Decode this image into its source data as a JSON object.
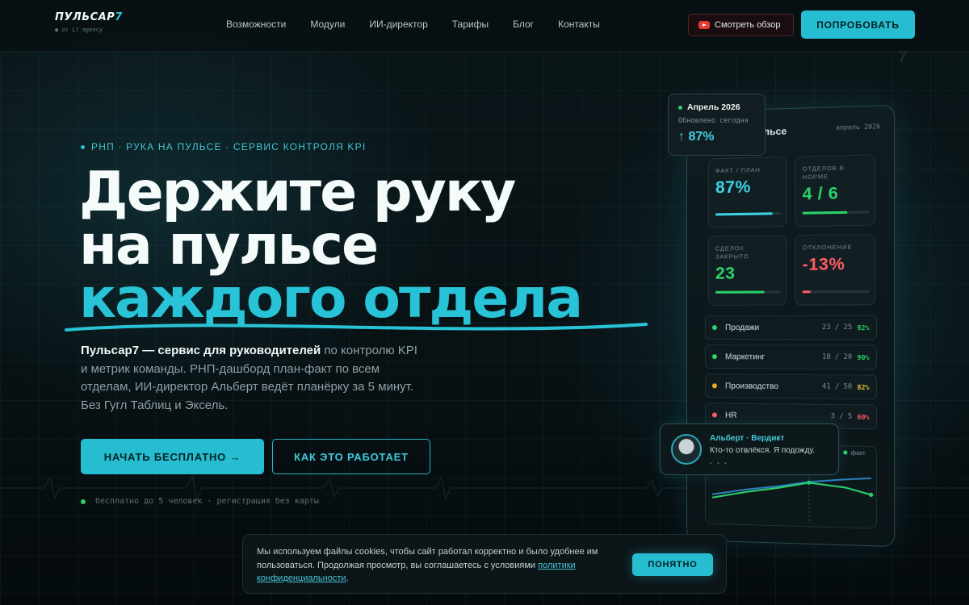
{
  "nav": {
    "logo": "ПУЛЬСАР",
    "logo_accent": "7",
    "logo_sub": "● от L7 agency",
    "links": [
      "Возможности",
      "Модули",
      "ИИ-директор",
      "Тарифы",
      "Блог",
      "Контакты"
    ],
    "review_label": "Смотреть обзор",
    "try_label": "ПОПРОБОВАТЬ"
  },
  "hero": {
    "eyebrow": "РНП · РУКА НА ПУЛЬСЕ · СЕРВИС КОНТРОЛЯ KPI",
    "title_line1": "Держите руку",
    "title_line2": "на пульсе",
    "title_accent": "каждого отдела",
    "desc_bold": "Пульсар7 — сервис для руководителей",
    "desc_rest": " по контролю KPI и метрик команды. РНП-дашборд план-факт по всем отделам, ИИ-директор Альберт ведёт планёрку за 5 минут. Без Гугл Таблиц и Эксель.",
    "cta_primary": "НАЧАТЬ БЕСПЛАТНО →",
    "cta_secondary": "КАК ЭТО РАБОТАЕТ",
    "note": "бесплатно до 5 человек · регистрация без карты"
  },
  "month_card": {
    "title": "Апрель 2026",
    "sub": "Обновлено сегодня",
    "value": "↑ 87%"
  },
  "dashboard": {
    "title": "пульсе",
    "date": "апрель 2026",
    "kpis": [
      {
        "label": "ФАКТ / ПЛАН",
        "value": "87%",
        "fill": 0.87,
        "color": "#3fd2e4"
      },
      {
        "label": "ОТДЕЛОВ В НОРМЕ",
        "value": "4 / 6",
        "fill": 0.67,
        "color": "#2bd36a"
      },
      {
        "label": "СДЕЛОК ЗАКРЫТО",
        "value": "23",
        "fill": 0.75,
        "color": "#2bd36a"
      },
      {
        "label": "ОТКЛОНЕНИЕ",
        "value": "-13%",
        "fill": 0.13,
        "color": "#ff5b64"
      }
    ],
    "departments": [
      {
        "name": "Продажи",
        "num": "23 / 25",
        "pct": "92%",
        "dot": "#2bd36a",
        "pct_color": "#2bd36a"
      },
      {
        "name": "Маркетинг",
        "num": "18 / 20",
        "pct": "90%",
        "dot": "#2bd36a",
        "pct_color": "#2bd36a"
      },
      {
        "name": "Производство",
        "num": "41 / 50",
        "pct": "82%",
        "dot": "#f0a92a",
        "pct_color": "#f0c43a"
      },
      {
        "name": "HR",
        "num": "3 / 5",
        "pct": "60%",
        "dot": "#ff5b64",
        "pct_color": "#ff5b64"
      }
    ],
    "legend": "факт"
  },
  "verdict": {
    "title": "Альберт · Вердикт",
    "text": "Кто-то отвлёкся. Я подожду.",
    "dots": "• • •"
  },
  "cookie": {
    "text": "Мы используем файлы cookies, чтобы сайт работал корректно и было удобнее им пользоваться. Продолжая просмотр, вы соглашаетесь с условиями",
    "link": "политики конфиденциальности",
    "button": "ПОНЯТНО"
  },
  "colors": {
    "accent": "#27bdd0",
    "bg": "#071013",
    "green": "#2bd36a",
    "red": "#ff5b64"
  }
}
